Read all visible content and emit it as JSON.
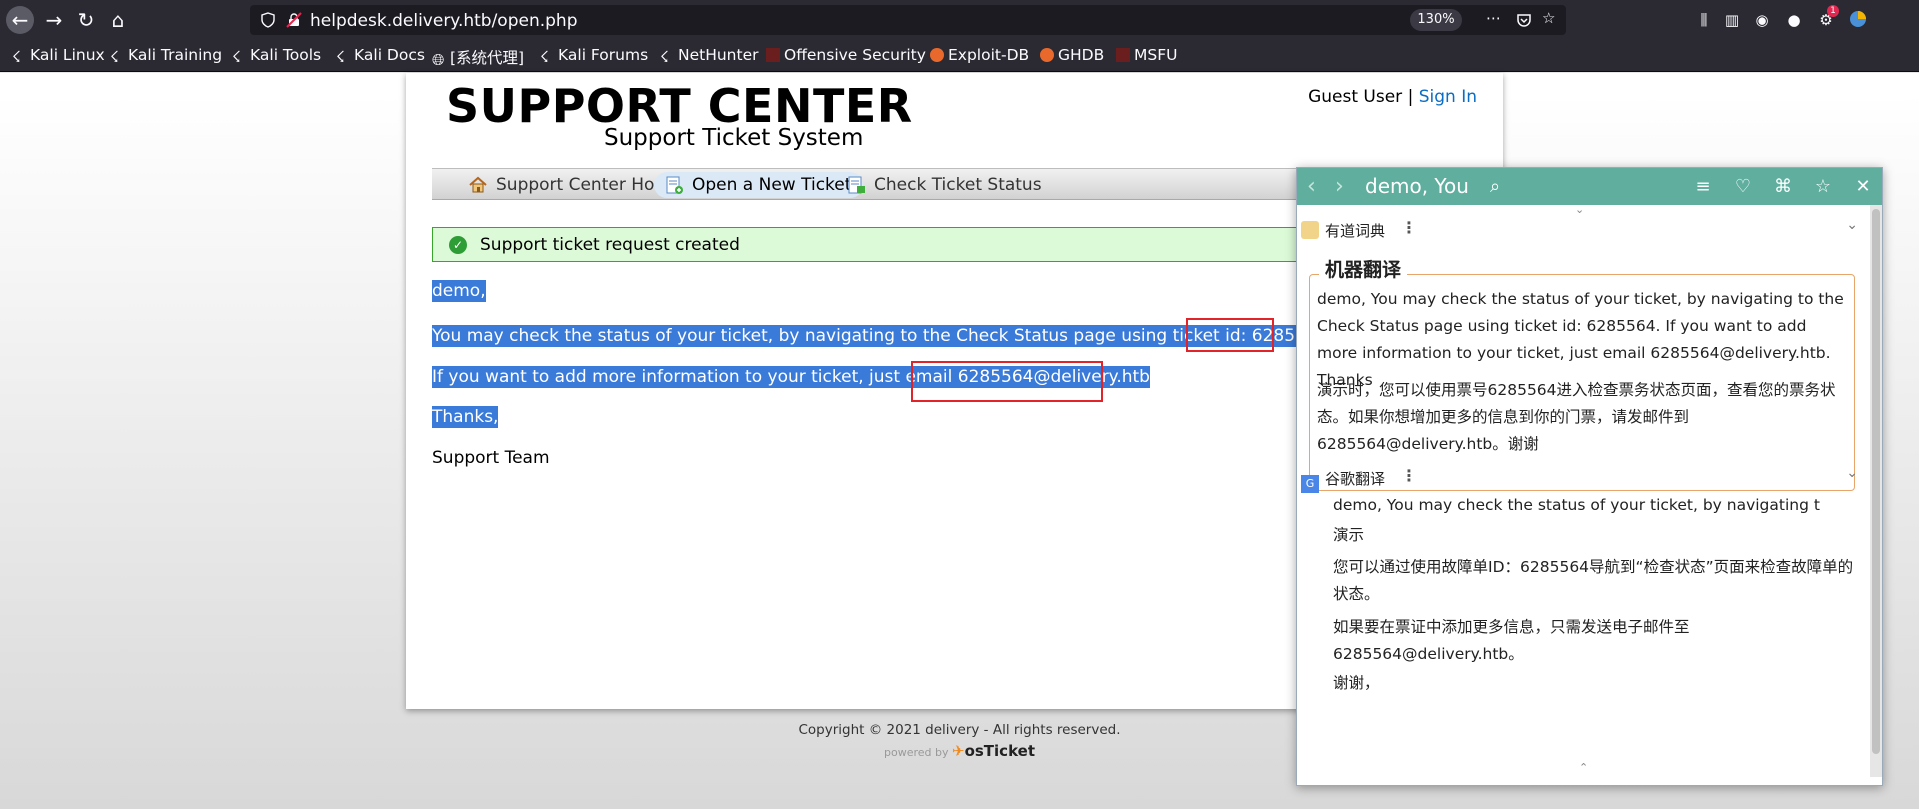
{
  "browser": {
    "url": "helpdesk.delivery.htb/open.php",
    "zoom": "130%",
    "bookmarks": [
      "Kali Linux",
      "Kali Training",
      "Kali Tools",
      "Kali Docs",
      "[系统代理]",
      "Kali Forums",
      "NetHunter",
      "Offensive Security",
      "Exploit-DB",
      "GHDB",
      "MSFU"
    ],
    "notification_count": "1"
  },
  "header": {
    "title": "SUPPORT CENTER",
    "subtitle": "Support Ticket System",
    "guest_label": "Guest User",
    "separator": "|",
    "sign_in": "Sign In"
  },
  "nav": {
    "home": "Support Center Home",
    "new_ticket": "Open a New Ticket",
    "check_status": "Check Ticket Status"
  },
  "notice": "Support ticket request created",
  "message": {
    "greeting": "demo,",
    "line1": "You may check the status of your ticket, by navigating to the Check Status page using ticket id:",
    "ticket_id": "6285564",
    "line1_end": ".",
    "line2": "If you want to add more information to your ticket, just email",
    "email": "6285564@delivery.htb",
    "thanks": "Thanks,",
    "signature": "Support Team"
  },
  "footer": {
    "copyright": "Copyright © 2021 delivery - All rights reserved.",
    "powered_by": "powered by",
    "brand": "osTicket"
  },
  "popup": {
    "query": "demo, You",
    "youdao_label": "有道词典",
    "machine_title": "机器翻译",
    "machine_en": "demo, You may check the status of your ticket, by navigating to the Check Status page using ticket id: 6285564. If you want to add more information to your ticket, just email 6285564@delivery.htb. Thanks",
    "machine_zh": "演示时，您可以使用票号6285564进入检查票务状态页面，查看您的票务状态。如果你想增加更多的信息到你的门票，请发邮件到6285564@delivery.htb。谢谢",
    "google_label": "谷歌翻译",
    "google_en": "demo, You may check the status of your ticket, by navigating t",
    "google_lines": [
      "演示",
      "您可以通过使用故障单ID：6285564导航到“检查状态”页面来检查故障单的状态。",
      "如果要在票证中添加更多信息，只需发送电子邮件至6285564@delivery.htb。",
      "谢谢，"
    ]
  },
  "colors": {
    "selection": "#3a7ad8",
    "popup_header": "#5fae9e",
    "link": "#0a6cc4",
    "notice_bg": "#dcfad8",
    "highlight_box": "#e0242a"
  }
}
